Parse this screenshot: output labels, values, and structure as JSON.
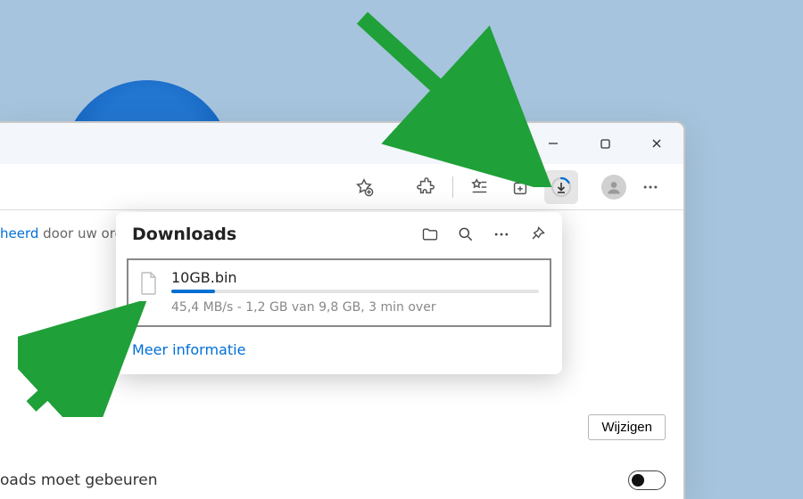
{
  "downloads": {
    "panel_title": "Downloads",
    "item": {
      "filename": "10GB.bin",
      "stats": "45,4 MB/s - 1,2 GB van 9,8 GB, 3 min over",
      "progress_percent": 12
    },
    "more_link": "Meer informatie"
  },
  "page": {
    "managed_prefix": "heerd",
    "managed_text": " door uw org",
    "toggle_label": "oads moet gebeuren"
  },
  "buttons": {
    "change": "Wijzigen"
  },
  "icons": {
    "add_favorite": "add-favorite-icon",
    "extensions": "extensions-icon",
    "favorites": "favorites-list-icon",
    "collections": "collections-icon",
    "download": "download-icon",
    "profile": "profile-avatar",
    "more": "more-icon",
    "minimize": "minimize-icon",
    "maximize": "maximize-icon",
    "close": "close-icon",
    "folder": "folder-icon",
    "search": "search-icon",
    "pin": "pin-icon"
  }
}
